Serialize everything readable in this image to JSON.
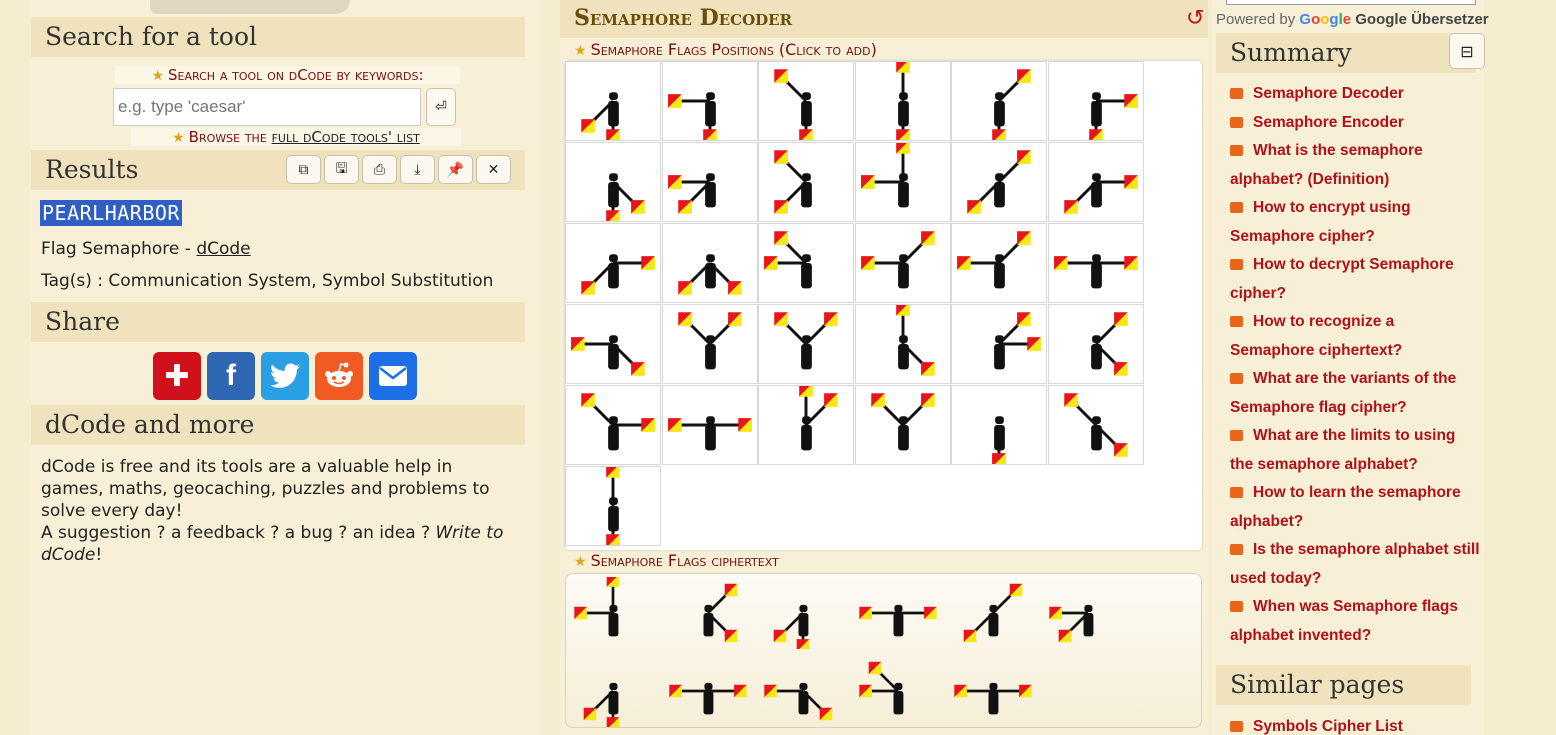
{
  "left": {
    "search_header": "Search for a tool",
    "search_label": "Search a tool on dCode by keywords:",
    "search_placeholder": "e.g. type 'caesar'",
    "browse_prefix": "Browse the ",
    "browse_link": "full dCode tools' list",
    "results_header": "Results",
    "result_value": "PEARLHARBOR",
    "result_source_prefix": "Flag Semaphore - ",
    "result_source_link": "dCode",
    "result_tags": "Tag(s) : Communication System, Symbol Substitution",
    "share_header": "Share",
    "more_header": "dCode and more",
    "more_text": "dCode is free and its tools are a valuable help in games, maths, geocaching, puzzles and problems to solve every day!",
    "suggest_text": "A suggestion ? a feedback ? a bug ? an idea ? ",
    "write_to": "Write to dCode",
    "excl": "!"
  },
  "middle": {
    "title": "Semaphore Decoder",
    "flags_label": "Semaphore Flags Positions (Click to add)",
    "ciphertext_label": "Semaphore Flags ciphertext"
  },
  "right": {
    "powered_by": "Powered by",
    "google": "Google",
    "translate": "Google Übersetzer",
    "summary_header": "Summary",
    "collapse": "⊟",
    "summary_items": [
      "Semaphore Decoder",
      "Semaphore Encoder",
      "What is the semaphore alphabet? (Definition)",
      "How to encrypt using Semaphore cipher?",
      "How to decrypt Semaphore cipher?",
      "How to recognize a Semaphore ciphertext?",
      "What are the variants of the Semaphore flag cipher?",
      "What are the limits to using the semaphore alphabet?",
      "How to learn the semaphore alphabet?",
      "Is the semaphore alphabet still used today?",
      "When was Semaphore flags alphabet invented?"
    ],
    "similar_header": "Similar pages",
    "similar_items": [
      "Symbols Cipher List"
    ]
  },
  "colors": {
    "flag_red": "#e8161b",
    "flag_yellow": "#f6e715",
    "link_red": "#b2111b",
    "result_highlight": "#2f5fc4"
  },
  "icons": {
    "toolbar": [
      "copy-icon",
      "floppy-icon",
      "print-icon",
      "download-icon",
      "pin-icon",
      "close-icon"
    ],
    "share": [
      "addthis-plus-icon",
      "facebook-icon",
      "twitter-icon",
      "reddit-icon",
      "email-icon"
    ]
  }
}
